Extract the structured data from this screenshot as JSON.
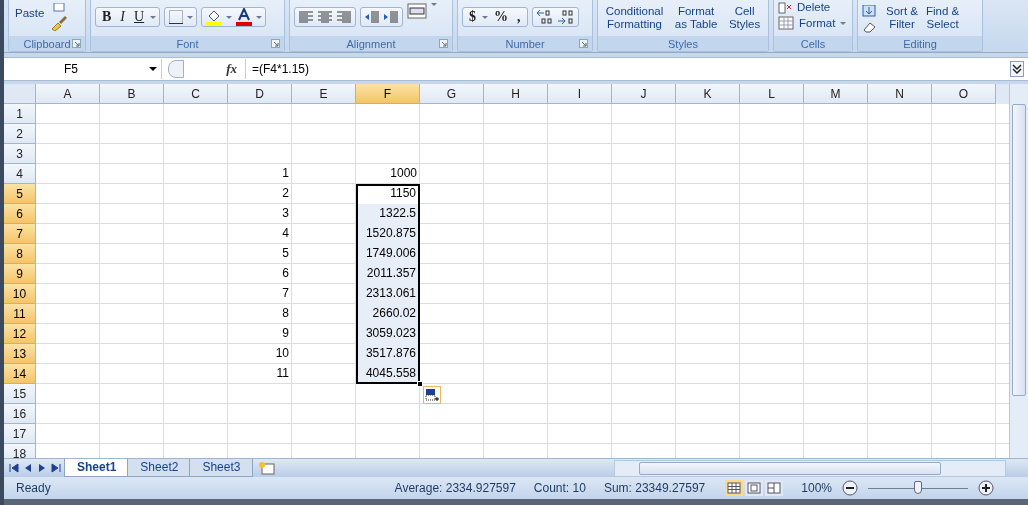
{
  "ribbon": [
    {
      "kind": "clipboard",
      "label": "Clipboard",
      "launcher": true,
      "buttons": [
        "Paste"
      ]
    },
    {
      "kind": "font",
      "label": "Font",
      "launcher": true,
      "buttons": [
        "B",
        "I",
        "U"
      ]
    },
    {
      "kind": "alignment",
      "label": "Alignment",
      "launcher": true
    },
    {
      "kind": "number",
      "label": "Number",
      "launcher": true,
      "buttons": [
        "$",
        "%",
        ","
      ]
    },
    {
      "kind": "styles",
      "label": "Styles",
      "launcher": false,
      "buttons": [
        "Conditional\nFormatting",
        "Format\nas Table",
        "Cell\nStyles"
      ]
    },
    {
      "kind": "cells",
      "label": "Cells",
      "launcher": false,
      "buttons": [
        "Delete",
        "Format"
      ]
    },
    {
      "kind": "editing",
      "label": "Editing",
      "launcher": false,
      "buttons": [
        "Sort &\nFilter",
        "Find &\nSelect"
      ]
    }
  ],
  "formula_bar": {
    "name_box": "F5",
    "fx": "fx",
    "formula": "=(F4*1.15)"
  },
  "columns": [
    {
      "label": "A",
      "selected": false
    },
    {
      "label": "B",
      "selected": false
    },
    {
      "label": "C",
      "selected": false
    },
    {
      "label": "D",
      "selected": false
    },
    {
      "label": "E",
      "selected": false
    },
    {
      "label": "F",
      "selected": true
    },
    {
      "label": "G",
      "selected": false
    },
    {
      "label": "H",
      "selected": false
    },
    {
      "label": "I",
      "selected": false
    },
    {
      "label": "J",
      "selected": false
    },
    {
      "label": "K",
      "selected": false
    },
    {
      "label": "L",
      "selected": false
    },
    {
      "label": "M",
      "selected": false
    },
    {
      "label": "N",
      "selected": false
    },
    {
      "label": "O",
      "selected": false
    }
  ],
  "rows": [
    {
      "label": "1",
      "selected": false
    },
    {
      "label": "2",
      "selected": false
    },
    {
      "label": "3",
      "selected": false
    },
    {
      "label": "4",
      "selected": false,
      "cells": {
        "D": "1",
        "F": "1000"
      }
    },
    {
      "label": "5",
      "selected": true,
      "cells": {
        "D": "2",
        "F": "1150"
      }
    },
    {
      "label": "6",
      "selected": true,
      "cells": {
        "D": "3",
        "F": "1322.5"
      }
    },
    {
      "label": "7",
      "selected": true,
      "cells": {
        "D": "4",
        "F": "1520.875"
      }
    },
    {
      "label": "8",
      "selected": true,
      "cells": {
        "D": "5",
        "F": "1749.006"
      }
    },
    {
      "label": "9",
      "selected": true,
      "cells": {
        "D": "6",
        "F": "2011.357"
      }
    },
    {
      "label": "10",
      "selected": true,
      "cells": {
        "D": "7",
        "F": "2313.061"
      }
    },
    {
      "label": "11",
      "selected": true,
      "cells": {
        "D": "8",
        "F": "2660.02"
      }
    },
    {
      "label": "12",
      "selected": true,
      "cells": {
        "D": "9",
        "F": "3059.023"
      }
    },
    {
      "label": "13",
      "selected": true,
      "cells": {
        "D": "10",
        "F": "3517.876"
      }
    },
    {
      "label": "14",
      "selected": true,
      "cells": {
        "D": "11",
        "F": "4045.558"
      }
    },
    {
      "label": "15",
      "selected": false
    },
    {
      "label": "16",
      "selected": false
    },
    {
      "label": "17",
      "selected": false
    },
    {
      "label": "18",
      "selected": false
    }
  ],
  "sheet_tabs": [
    {
      "label": "Sheet1",
      "selected": true
    },
    {
      "label": "Sheet2",
      "selected": false
    },
    {
      "label": "Sheet3",
      "selected": false
    }
  ],
  "status_bar": {
    "status": "Ready",
    "stats": [
      "Average: 2334.927597",
      "Count: 10",
      "Sum: 23349.27597"
    ],
    "views": [
      {
        "selected": true
      },
      {
        "selected": false
      },
      {
        "selected": false
      }
    ],
    "zoom": "100%",
    "zoom_slider": {
      "level": 0.5
    }
  }
}
